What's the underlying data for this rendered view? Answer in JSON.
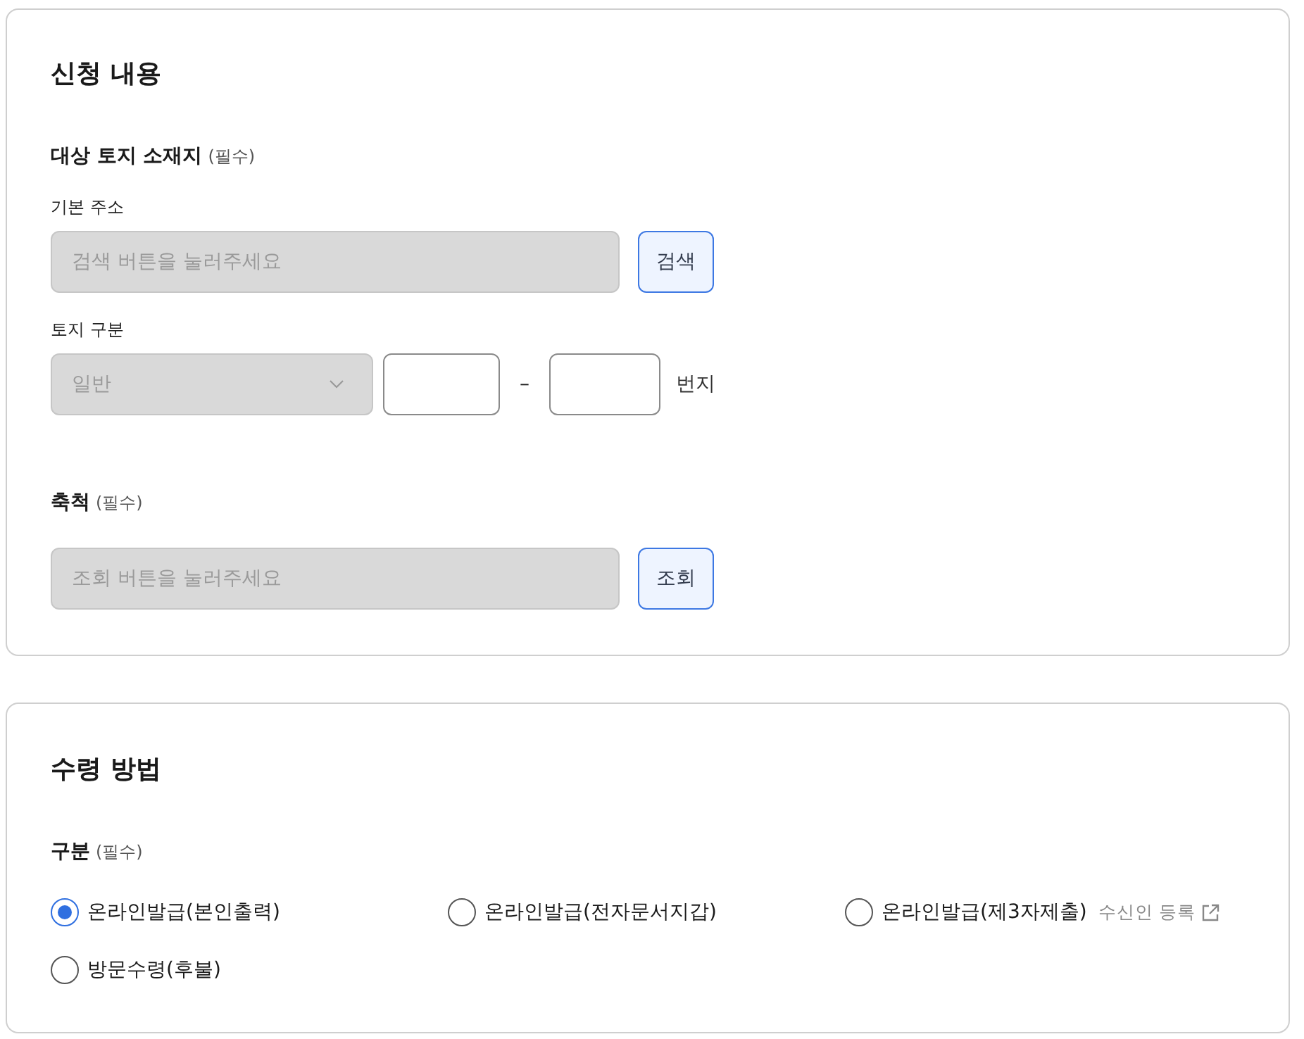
{
  "application": {
    "title": "신청 내용",
    "location": {
      "label": "대상 토지 소재지",
      "required": "(필수)",
      "address": {
        "label": "기본 주소",
        "placeholder": "검색 버튼을 눌러주세요",
        "disabled": true,
        "button": "검색"
      },
      "land_type": {
        "label": "토지 구분",
        "select": {
          "value": "일반",
          "disabled": true
        },
        "separator": "–",
        "suffix": "번지"
      }
    },
    "scale": {
      "label": "축척",
      "required": "(필수)",
      "placeholder": "조회 버튼을 눌러주세요",
      "disabled": true,
      "button": "조회"
    }
  },
  "receipt": {
    "title": "수령 방법",
    "label": "구분",
    "required": "(필수)",
    "options": [
      {
        "label": "온라인발급(본인출력)",
        "selected": true
      },
      {
        "label": "온라인발급(전자문서지갑)",
        "selected": false
      },
      {
        "label": "온라인발급(제3자제출)",
        "selected": false,
        "link": "수신인 등록"
      },
      {
        "label": "방문수령(후불)",
        "selected": false
      }
    ]
  }
}
